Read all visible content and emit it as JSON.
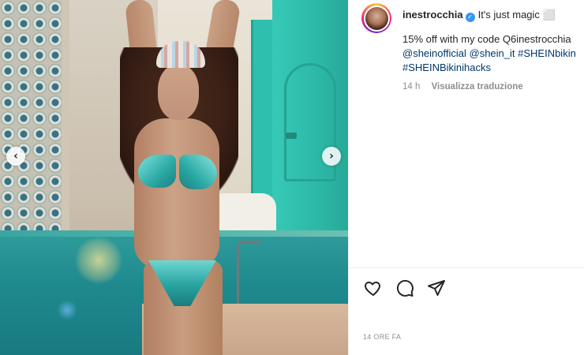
{
  "post": {
    "image_description": "",
    "nav_prev_symbol": "‹",
    "nav_next_symbol": "›"
  },
  "author": {
    "username": "inestrocchia",
    "verified_symbol": "✓",
    "verified_color": "#3897f0"
  },
  "caption": {
    "first_line": "It's just magic ⬜",
    "lines": [
      "15% off with my code Q6inestrocchia",
      "@sheinofficial @shein_it #SHEINbikin",
      "#SHEINBikinihacks"
    ]
  },
  "meta": {
    "age": "14 h",
    "translate_label": "Visualizza traduzione"
  },
  "actions": {
    "like_icon": "heart-icon",
    "comment_icon": "comment-icon",
    "share_icon": "paper-plane-icon"
  },
  "timestamp": "14 ORE FA",
  "colors": {
    "link": "#00376b",
    "muted": "#8e8e8e",
    "text": "#262626"
  }
}
